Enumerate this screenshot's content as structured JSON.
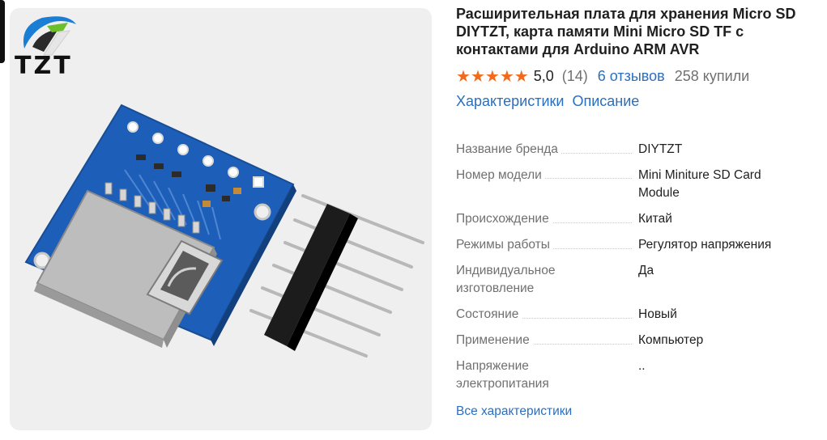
{
  "brand_logo_text": "TZT",
  "product": {
    "title": "Расширительная плата для хранения Micro SD DIYTZT, карта памяти Mini Micro SD TF с контактами для Arduino ARM AVR",
    "rating_value": "5,0",
    "rating_count": "(14)",
    "reviews_link": "6 отзывов",
    "bought": "258 купили",
    "stars": 5,
    "star_color": "#f26a1b"
  },
  "tabs": [
    {
      "label": "Характеристики"
    },
    {
      "label": "Описание"
    }
  ],
  "specs": [
    {
      "label": "Название бренда",
      "value": "DIYTZT"
    },
    {
      "label": "Номер модели",
      "value": "Mini Miniture SD Card Module"
    },
    {
      "label": "Происхождение",
      "value": "Китай"
    },
    {
      "label": "Режимы работы",
      "value": "Регулятор напряжения"
    },
    {
      "label": "Индивидуальное изготовление",
      "value": "Да"
    },
    {
      "label": "Состояние",
      "value": "Новый"
    },
    {
      "label": "Применение",
      "value": "Компьютер"
    },
    {
      "label": "Напряжение электропитания",
      "value": ".."
    }
  ],
  "all_specs_link": "Все характеристики",
  "colors": {
    "link": "#2a6fbf",
    "muted": "#707070",
    "pcb": "#1d5fb8"
  }
}
